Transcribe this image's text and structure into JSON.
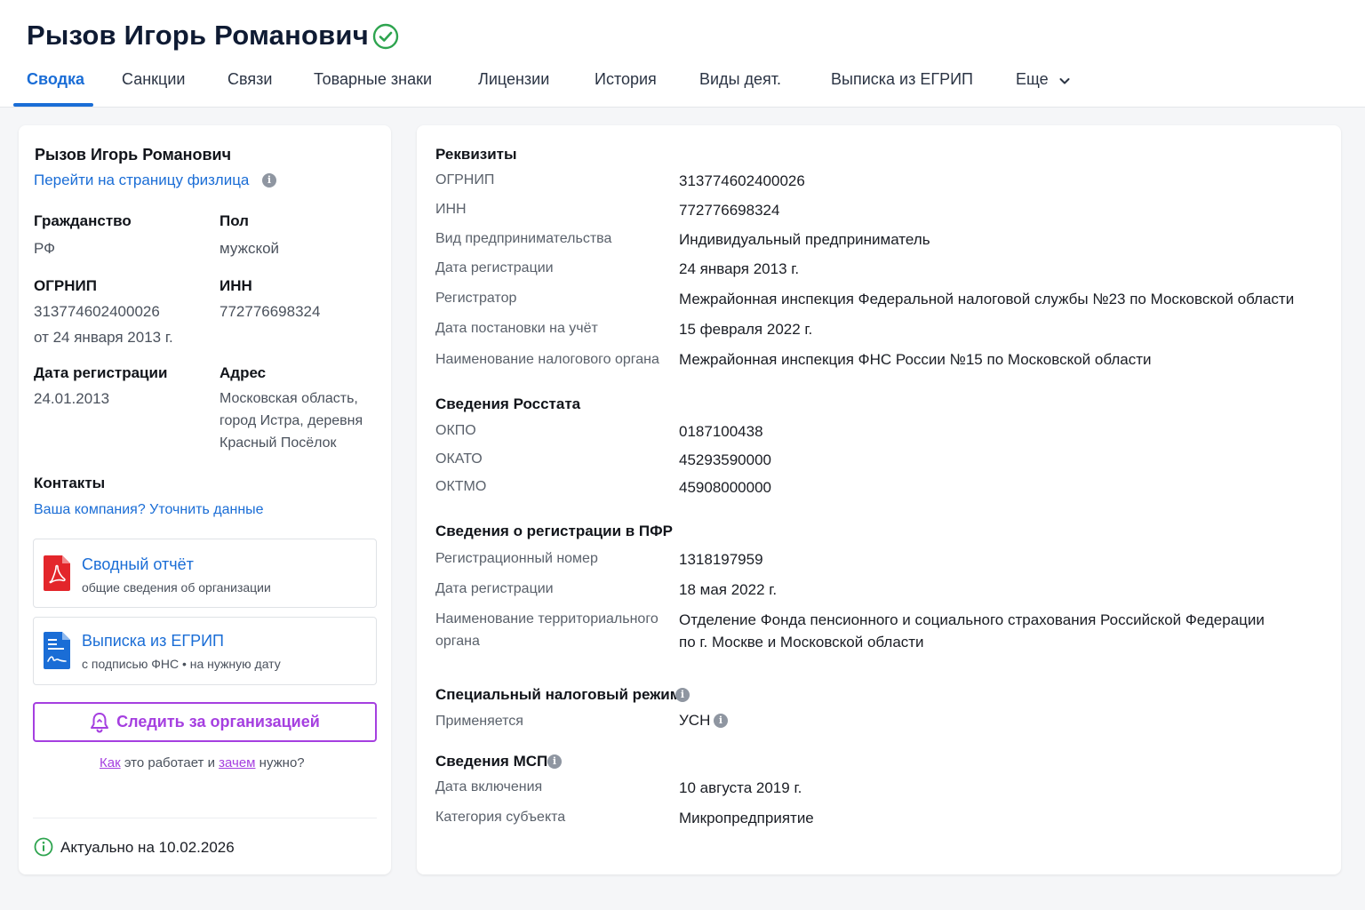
{
  "header": {
    "title": "Рызов Игорь Романович",
    "tabs": [
      {
        "label": "Сводка"
      },
      {
        "label": "Санкции"
      },
      {
        "label": "Связи"
      },
      {
        "label": "Товарные знаки"
      },
      {
        "label": "Лицензии"
      },
      {
        "label": "История"
      },
      {
        "label": "Виды деят."
      },
      {
        "label": "Выписка из ЕГРИП"
      },
      {
        "label": "Еще"
      }
    ]
  },
  "left": {
    "name": "Рызов Игорь Романович",
    "person_link": "Перейти на страницу физлица",
    "citizenship_label": "Гражданство",
    "citizenship_value": "РФ",
    "gender_label": "Пол",
    "gender_value": "мужской",
    "ogrnip_label": "ОГРНИП",
    "ogrnip_value": "313774602400026",
    "ogrnip_date": "от 24 января 2013 г.",
    "inn_label": "ИНН",
    "inn_value": "772776698324",
    "regdate_label": "Дата регистрации",
    "regdate_value": "24.01.2013",
    "address_label": "Адрес",
    "address_lines": [
      "Московская область,",
      "город Истра, деревня",
      "Красный Посёлок"
    ],
    "contacts_label": "Контакты",
    "contacts_link": "Ваша компания? Уточнить данные",
    "report_title": "Сводный отчёт",
    "report_sub": "общие сведения об организации",
    "egrip_title": "Выписка из ЕГРИП",
    "egrip_sub": "с подписью ФНС • на нужную дату",
    "follow_label": "Следить за организацией",
    "how_1": "Как",
    "how_2": " это работает и ",
    "how_3": "зачем",
    "how_4": " нужно?",
    "actual": "Актуально на 10.02.2026"
  },
  "right": {
    "requisites_title": "Реквизиты",
    "requisites": [
      {
        "label": "ОГРНИП",
        "value": "313774602400026"
      },
      {
        "label": "ИНН",
        "value": "772776698324"
      },
      {
        "label": "Вид предпринимательства",
        "value": "Индивидуальный предприниматель"
      },
      {
        "label": "Дата регистрации",
        "value": "24 января 2013 г."
      },
      {
        "label": "Регистратор",
        "value": "Межрайонная инспекция Федеральной налоговой службы №23 по Московской области"
      },
      {
        "label": "Дата постановки на учёт",
        "value": "15 февраля 2022 г."
      },
      {
        "label": "Наименование налогового органа",
        "value": "Межрайонная инспекция ФНС России №15 по Московской области"
      }
    ],
    "rosstat_title": "Сведения Росстата",
    "rosstat": [
      {
        "label": "ОКПО",
        "value": "0187100438"
      },
      {
        "label": "ОКАТО",
        "value": "45293590000"
      },
      {
        "label": "ОКТМО",
        "value": "45908000000"
      }
    ],
    "pfr_title": "Сведения о регистрации в ПФР",
    "pfr": [
      {
        "label": "Регистрационный номер",
        "value": "1318197959"
      },
      {
        "label": "Дата регистрации",
        "value": "18 мая 2022 г."
      }
    ],
    "pfr_org_label_1": "Наименование территориального",
    "pfr_org_label_2": "органа",
    "pfr_org_value_1": "Отделение Фонда пенсионного и социального страхования Российской Федерации",
    "pfr_org_value_2": "по г. Москве и Московской области",
    "tax_title": "Специальный налоговый режим",
    "tax_label": "Применяется",
    "tax_value": "УСН",
    "msp_title": "Сведения МСП",
    "msp": [
      {
        "label": "Дата включения",
        "value": "10 августа 2019 г."
      },
      {
        "label": "Категория субъекта",
        "value": "Микропредприятие"
      }
    ]
  },
  "colors": {
    "accent": "#1a6dd6",
    "follow": "#a53fe0",
    "verified": "#2ea44f"
  }
}
